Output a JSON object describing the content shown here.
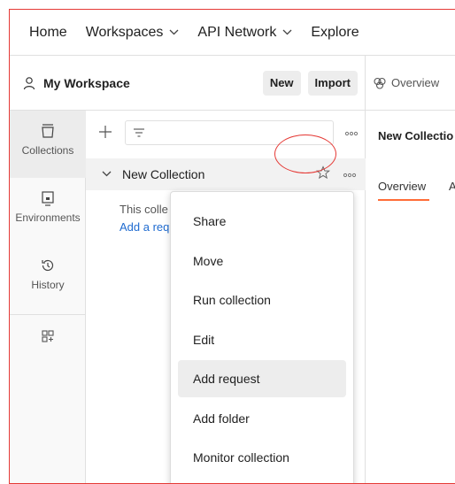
{
  "topnav": {
    "items": [
      {
        "label": "Home",
        "has_dropdown": false
      },
      {
        "label": "Workspaces",
        "has_dropdown": true
      },
      {
        "label": "API Network",
        "has_dropdown": true
      },
      {
        "label": "Explore",
        "has_dropdown": false
      }
    ]
  },
  "workspace": {
    "name": "My Workspace",
    "new_label": "New",
    "import_label": "Import"
  },
  "tabs": {
    "overview_label": "Overview"
  },
  "rail": {
    "items": [
      {
        "label": "Collections",
        "icon": "collections-icon",
        "active": true
      },
      {
        "label": "Environments",
        "icon": "environments-icon",
        "active": false
      },
      {
        "label": "History",
        "icon": "history-icon",
        "active": false
      }
    ]
  },
  "collections": {
    "collection_name": "New Collection",
    "empty_text": "This colle",
    "add_request_link": "Add a req"
  },
  "content": {
    "title": "New Collectio",
    "tab_overview": "Overview",
    "tab_second": "A"
  },
  "context_menu": {
    "items": [
      {
        "label": "Share",
        "hover": false
      },
      {
        "label": "Move",
        "hover": false
      },
      {
        "label": "Run collection",
        "hover": false
      },
      {
        "label": "Edit",
        "hover": false
      },
      {
        "label": "Add request",
        "hover": true
      },
      {
        "label": "Add folder",
        "hover": false
      },
      {
        "label": "Monitor collection",
        "hover": false
      }
    ]
  },
  "colors": {
    "accent": "#ff6c37",
    "link": "#1f6bd0",
    "annotation": "#e53935"
  }
}
